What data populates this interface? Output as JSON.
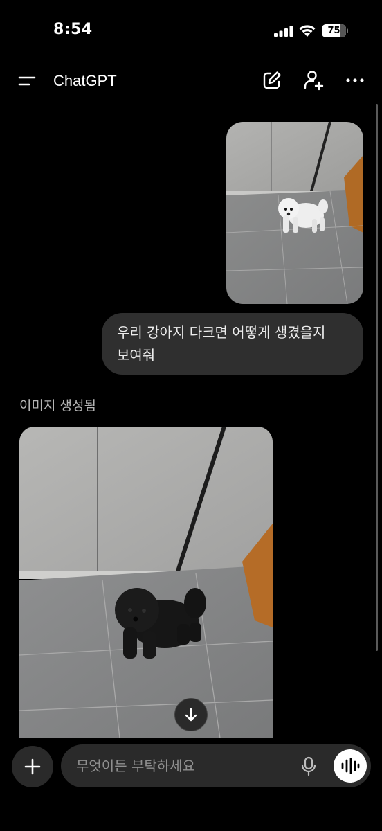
{
  "status_bar": {
    "time": "8:54",
    "battery_percent": "75",
    "battery_level": 0.75,
    "icons": [
      "signal-icon",
      "wifi-icon",
      "battery-icon"
    ]
  },
  "header": {
    "title": "ChatGPT",
    "icons": [
      "menu-icon",
      "new-chat-icon",
      "add-person-icon",
      "more-icon"
    ]
  },
  "conversation": {
    "user_message": {
      "image": "white dog photo",
      "text_line1": "우리 강아지 다크면 어떻게 생겼을지",
      "text_line2": "보여줘"
    },
    "assistant_message": {
      "status_label": "이미지 생성됨",
      "image": "black dog photo"
    }
  },
  "composer": {
    "placeholder": "무엇이든 부탁하세요",
    "icons": [
      "plus-icon",
      "microphone-icon",
      "voice-mode-icon",
      "arrow-down-icon"
    ]
  },
  "colors": {
    "background": "#000000",
    "bubble": "#2f2f2f",
    "input": "#2a2a2a",
    "muted_text": "#b4b4b4"
  }
}
